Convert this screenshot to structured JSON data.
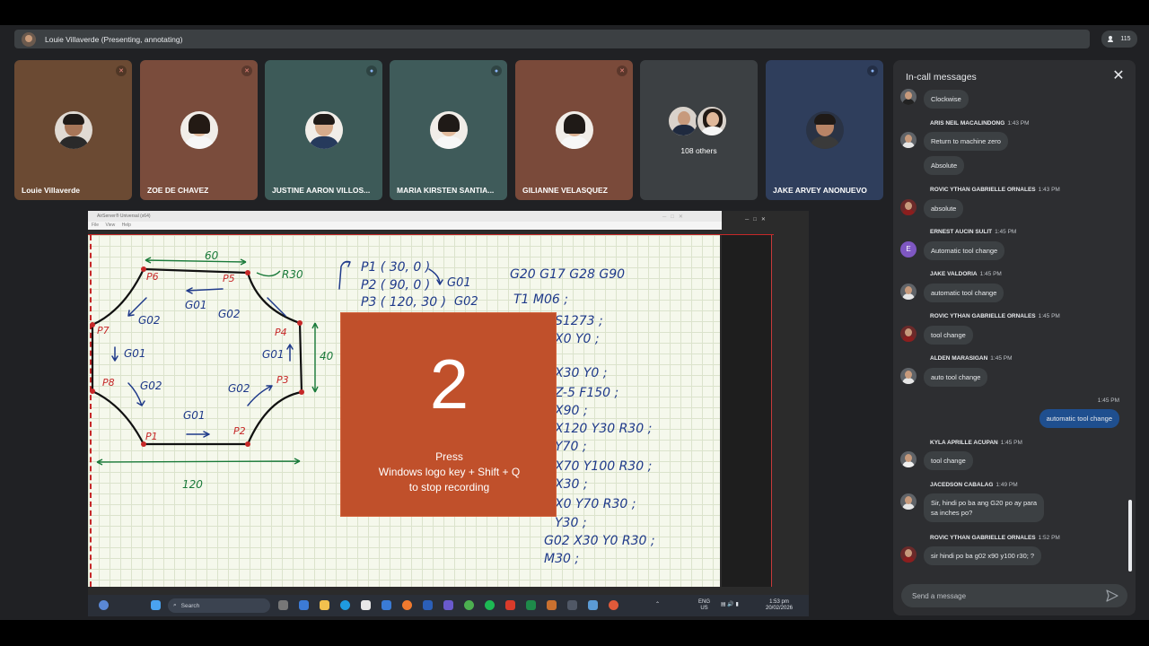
{
  "presenter": {
    "label": "Louie Villaverde (Presenting, annotating)"
  },
  "people_count": "115",
  "tiles": [
    {
      "name": "Louie Villaverde",
      "bg": "#6b4a33",
      "mic": "muted"
    },
    {
      "name": "ZOE DE CHAVEZ",
      "bg": "#7a4c3c",
      "mic": "muted"
    },
    {
      "name": "JUSTINE AARON VILLOS...",
      "bg": "#3d5a58",
      "mic": "on"
    },
    {
      "name": "MARIA KIRSTEN SANTIA...",
      "bg": "#3f5b5a",
      "mic": "on"
    },
    {
      "name": "GILIANNE VELASQUEZ",
      "bg": "#7a4a3a",
      "mic": "muted"
    },
    {
      "name": "108 others",
      "bg": "#3c4043",
      "mic": ""
    },
    {
      "name": "JAKE ARVEY ANONUEVO",
      "bg": "#2f3e5c",
      "mic": "on"
    }
  ],
  "shared_window": {
    "title": "AirServer® Universal (x64)",
    "menu": [
      "File",
      "View",
      "Help"
    ]
  },
  "whiteboard": {
    "notes": [
      "P1 ( 30, 0 )",
      "P2 ( 90, 0 )",
      "P3 ( 120, 30 )",
      "G20 G17 G28 G90",
      "T1 M06 ;",
      "S1273 ;",
      "X0 Y0 ;",
      "X30 Y0 ;",
      "Z-5 F150 ;",
      "X90 ;",
      "X120 Y30 R30 ;",
      "Y70 ;",
      "X70 Y100 R30 ;",
      "X30 ;",
      "X0 Y70 R30 ;",
      "Y30 ;",
      "G02 X30 Y0 R30 ;",
      "M30 ;"
    ]
  },
  "recording_overlay": {
    "countdown": "2",
    "message": "Press\nWindows logo key + Shift + Q\nto stop recording"
  },
  "taskbar": {
    "search_placeholder": "Search",
    "lang": "ENG",
    "region": "US",
    "time": "1:53 pm",
    "date": "20/02/2026"
  },
  "chat": {
    "title": "In-call messages",
    "compose_placeholder": "Send a message",
    "messages": [
      {
        "sender": "",
        "time": "",
        "text": "Clockwise"
      },
      {
        "sender": "ARIS NEIL MACALINDONG",
        "time": "1:43 PM",
        "text": "Return to machine zero"
      },
      {
        "sender": "",
        "time": "",
        "text": "Absolute"
      },
      {
        "sender": "ROVIC YTHAN GABRIELLE ORNALES",
        "time": "1:43 PM",
        "text": "absolute"
      },
      {
        "sender": "ERNEST AUCIN SULIT",
        "time": "1:45 PM",
        "text": "Automatic tool change",
        "avatar_letter": "E"
      },
      {
        "sender": "JAKE VALDORIA",
        "time": "1:45 PM",
        "text": "automatic tool change"
      },
      {
        "sender": "ROVIC YTHAN GABRIELLE ORNALES",
        "time": "1:45 PM",
        "text": "tool change"
      },
      {
        "sender": "ALDEN MARASIGAN",
        "time": "1:45 PM",
        "text": "auto tool change"
      },
      {
        "sender": "self",
        "time": "1:45 PM",
        "text": "automatic tool change"
      },
      {
        "sender": "KYLA APRILLE ACUPAN",
        "time": "1:45 PM",
        "text": "tool change"
      },
      {
        "sender": "JACEDSON CABALAG",
        "time": "1:49 PM",
        "text": "Sir, hindi po ba ang G20 po ay para\nsa inches po?"
      },
      {
        "sender": "ROVIC YTHAN GABRIELLE ORNALES",
        "time": "1:52 PM",
        "text": "sir hindi po ba g02 x90 y100 r30; ?"
      }
    ]
  }
}
